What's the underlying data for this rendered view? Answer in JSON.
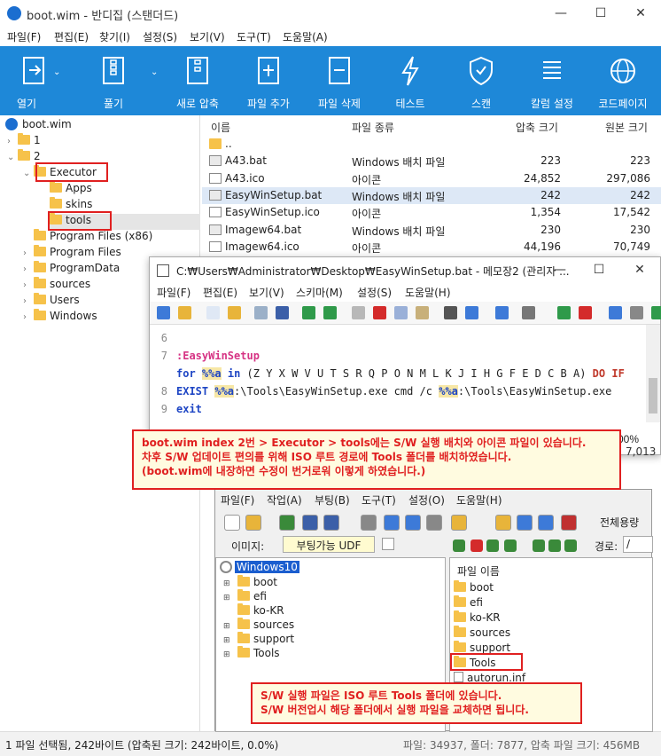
{
  "window": {
    "title": "boot.wim - 반디집 (스탠더드)",
    "minimize": "—",
    "maximize": "☐",
    "close": "✕"
  },
  "menu": [
    "파일(F)",
    "편집(E)",
    "찾기(I)",
    "설정(S)",
    "보기(V)",
    "도구(T)",
    "도움말(A)"
  ],
  "toolbar": [
    "열기",
    "풀기",
    "새로 압축",
    "파일 추가",
    "파일 삭제",
    "테스트",
    "스캔",
    "칼럼 설정",
    "코드페이지"
  ],
  "tree": {
    "root": "boot.wim",
    "items": [
      "1",
      "2",
      "Executor",
      "Apps",
      "skins",
      "tools",
      "Program Files (x86)",
      "Program Files",
      "ProgramData",
      "sources",
      "Users",
      "Windows"
    ]
  },
  "filelist": {
    "headers": [
      "이름",
      "파일 종류",
      "압축 크기",
      "원본 크기"
    ],
    "rows": [
      {
        "name": "..",
        "type": "",
        "packed": "",
        "size": ""
      },
      {
        "name": "A43.bat",
        "type": "Windows 배치 파일",
        "packed": "223",
        "size": "223"
      },
      {
        "name": "A43.ico",
        "type": "아이콘",
        "packed": "24,852",
        "size": "297,086"
      },
      {
        "name": "EasyWinSetup.bat",
        "type": "Windows 배치 파일",
        "packed": "242",
        "size": "242"
      },
      {
        "name": "EasyWinSetup.ico",
        "type": "아이콘",
        "packed": "1,354",
        "size": "17,542"
      },
      {
        "name": "Imagew64.bat",
        "type": "Windows 배치 파일",
        "packed": "230",
        "size": "230"
      },
      {
        "name": "Imagew64.ico",
        "type": "아이콘",
        "packed": "44,196",
        "size": "70,749"
      }
    ]
  },
  "status": "1 파일 선택됨, 242바이트 (압축된 크기: 242바이트, 0.0%)",
  "status_right": "파일: 34937, 폴더: 7877, 압축 파일 크기: 456MB",
  "notepad": {
    "title": "C:₩Users₩Administrator₩Desktop₩EasyWinSetup.bat - 메모장2 (관리자 ...",
    "menu": [
      "파일(F)",
      "편집(E)",
      "보기(V)",
      "스키마(M)",
      "설정(S)",
      "도움말(H)"
    ],
    "lines": [
      "6",
      "7",
      "8",
      "9"
    ],
    "code": {
      "label": ":EasyWinSetup",
      "for": "for",
      "var": "%%a",
      "in": "in",
      "letters": "(Z Y X W V U T S R Q P O N M L K J I H G F E D C B A)",
      "do": "DO",
      "if": "IF",
      "exist": "EXIST",
      "path1": ":\\Tools\\EasyWinSetup.exe cmd /c ",
      "path2": ":\\Tools\\EasyWinSetup.exe",
      "exit": "exit"
    },
    "zoom": "00%",
    "size_peek": "7,013"
  },
  "uiso": {
    "menu": [
      "파일(F)",
      "작업(A)",
      "부팅(B)",
      "도구(T)",
      "설정(O)",
      "도움말(H)"
    ],
    "image_label": "이미지:",
    "image_value": "부팅가능 UDF",
    "fullview": "전체용량",
    "path_label": "경로:",
    "path_value": "/",
    "tree": [
      "Windows10",
      "boot",
      "efi",
      "ko-KR",
      "sources",
      "support",
      "Tools"
    ],
    "files_header": "파일 이름",
    "files": [
      "boot",
      "efi",
      "ko-KR",
      "sources",
      "support",
      "Tools",
      "autorun.inf"
    ]
  },
  "callout1": [
    "boot.wim index 2번 > Executor > tools에는 S/W 실행 배치와 아이콘 파일이 있습니다.",
    "차후 S/W 업데이트 편의를 위해 ISO 루트 경로에 Tools 폴더를 배치하였습니다.",
    "(boot.wim에 내장하면 수정이 번거로워 이렇게 하였습니다.)"
  ],
  "callout2": [
    "S/W 실행 파일은 ISO 루트 Tools 폴더에 있습니다.",
    "S/W 버전업시 해당 폴더에서 실행 파일을 교체하면 됩니다."
  ],
  "colors": {
    "toolbar": "#1e88d8",
    "highlight": "#e02020",
    "callout_bg": "#fffbe0"
  }
}
